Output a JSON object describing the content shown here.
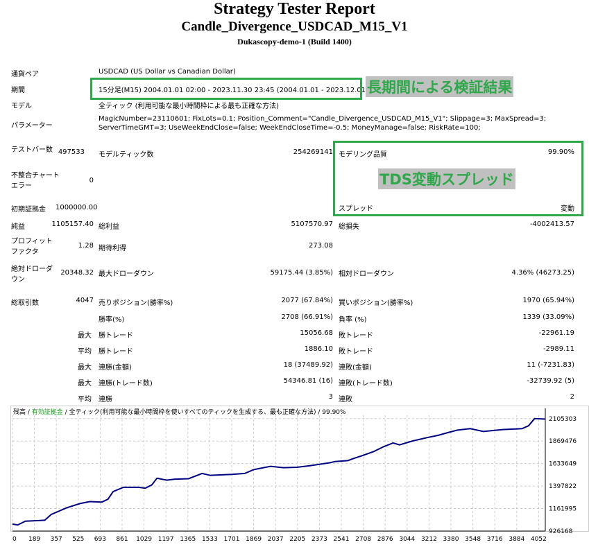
{
  "header": {
    "title": "Strategy Tester Report",
    "subtitle": "Candle_Divergence_USDCAD_M15_V1",
    "server": "Dukascopy-demo-1 (Build 1400)"
  },
  "info": {
    "pair_label": "通貨ペア",
    "pair": "USDCAD (US Dollar vs Canadian Dollar)",
    "period_label": "期間",
    "period": "15分足(M15) 2004.01.01 02:00 - 2023.11.30 23:45 (2004.01.01 - 2023.12.01)",
    "model_label": "モデル",
    "model": "全ティック (利用可能な最小時間枠による最も正確な方法)",
    "params_label": "パラメーター",
    "params_1": "MagicNumber=23110601; FixLots=0.1; Position_Comment=\"Candle_Divergence_USDCAD_M15_V1\"; Slippage=3; MaxSpread=3;",
    "params_2": "ServerTimeGMT=3; UseWeekEndClose=false; WeekEndCloseTime=-0.5; MoneyManage=false; RiskRate=100;"
  },
  "annotations": {
    "long_period": "長期間による検証結果",
    "tds": "TDS変動スプレッド"
  },
  "stats": {
    "bars_label": "テストバー数",
    "bars": "497533",
    "ticks_label": "モデルティック数",
    "ticks": "254269141",
    "quality_label": "モデリング品質",
    "quality": "99.90%",
    "mismatch_label": "不整合チャートエラー",
    "mismatch": "0",
    "deposit_label": "初期証拠金",
    "deposit": "1000000.00",
    "spread_label": "スプレッド",
    "spread": "変動",
    "net_label": "純益",
    "net": "1105157.40",
    "gross_profit_label": "総利益",
    "gross_profit": "5107570.97",
    "gross_loss_label": "総損失",
    "gross_loss": "-4002413.57",
    "pf_label": "プロフィットファクタ",
    "pf": "1.28",
    "exp_label": "期待利得",
    "exp": "273.08",
    "abs_dd_label": "絶対ドローダウン",
    "abs_dd": "20348.32",
    "max_dd_label": "最大ドローダウン",
    "max_dd": "59175.44 (3.85%)",
    "rel_dd_label": "相対ドローダウン",
    "rel_dd": "4.36% (46273.25)",
    "trades_label": "総取引数",
    "trades": "4047",
    "short_label": "売りポジション(勝率%)",
    "short": "2077 (67.84%)",
    "long_label": "買いポジション(勝率%)",
    "long": "1970 (65.94%)",
    "win_label": "勝率(%)",
    "win": "2708 (66.91%)",
    "loss_label": "負率 (%)",
    "loss": "1339 (33.09%)",
    "max": "最大",
    "avg": "平均",
    "lg_win_label": "勝トレード",
    "lg_win": "15056.68",
    "lg_loss_label": "敗トレード",
    "lg_loss": "-22961.19",
    "av_win_label": "勝トレード",
    "av_win": "1886.10",
    "av_loss_label": "敗トレード",
    "av_loss": "-2989.11",
    "cw_label": "連勝(金額)",
    "cw": "18 (37489.92)",
    "cl_label": "連敗(金額)",
    "cl": "11 (-7231.83)",
    "cwp_label": "連勝(トレード数)",
    "cwp": "54346.81 (16)",
    "clp_label": "連敗(トレード数)",
    "clp": "-32739.92 (5)",
    "acw_label": "連勝",
    "acw": "3",
    "acl_label": "連敗",
    "acl": "2"
  },
  "chart_data": {
    "type": "line",
    "legend": {
      "balance": "残高",
      "sep": " / ",
      "equity": "有効証拠金",
      "rest": " / 全ティック(利用可能な最小時間枠を使いすべてのティックを生成する、最も正確な方法) / 99.90%"
    },
    "x_ticks": [
      "0",
      "189",
      "357",
      "525",
      "693",
      "861",
      "1029",
      "1197",
      "1365",
      "1533",
      "1701",
      "1869",
      "2037",
      "2205",
      "2373",
      "2541",
      "2708",
      "2876",
      "3044",
      "3212",
      "3380",
      "3548",
      "3716",
      "3884",
      "4052"
    ],
    "y_ticks": [
      "2105303",
      "1869476",
      "1633649",
      "1397822",
      "1161995",
      "926168"
    ],
    "ylim": [
      926168,
      2140000
    ],
    "xlim": [
      0,
      4130
    ],
    "x": [
      0,
      40,
      100,
      189,
      250,
      300,
      420,
      525,
      600,
      693,
      740,
      780,
      861,
      980,
      1029,
      1080,
      1120,
      1197,
      1260,
      1365,
      1470,
      1533,
      1701,
      1800,
      1869,
      2000,
      2100,
      2205,
      2300,
      2373,
      2450,
      2500,
      2600,
      2650,
      2708,
      2800,
      2876,
      2950,
      3000,
      3100,
      3212,
      3300,
      3380,
      3450,
      3548,
      3650,
      3800,
      3950,
      4000,
      4047,
      4130
    ],
    "y": [
      1000000,
      990000,
      1030000,
      1035000,
      1040000,
      1100000,
      1170000,
      1215000,
      1235000,
      1230000,
      1260000,
      1340000,
      1385000,
      1385000,
      1375000,
      1410000,
      1480000,
      1460000,
      1470000,
      1475000,
      1530000,
      1510000,
      1520000,
      1530000,
      1570000,
      1605000,
      1590000,
      1595000,
      1610000,
      1625000,
      1640000,
      1655000,
      1665000,
      1690000,
      1715000,
      1760000,
      1810000,
      1850000,
      1830000,
      1870000,
      1905000,
      1930000,
      1960000,
      1985000,
      2000000,
      1970000,
      1990000,
      2000000,
      2030000,
      2105157,
      2100000
    ]
  }
}
